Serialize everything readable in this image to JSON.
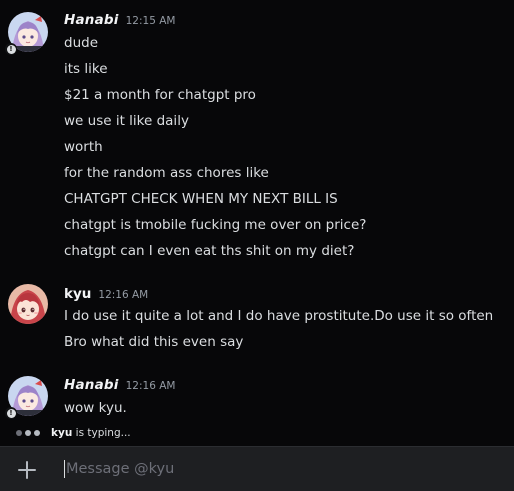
{
  "messages": [
    {
      "author": "Hanabi",
      "time": "12:15 AM",
      "lines": [
        "dude",
        "its like",
        "$21 a month for chatgpt pro",
        "we use it like daily",
        "worth",
        "for the random ass chores like",
        "CHATGPT CHECK WHEN MY NEXT BILL IS",
        "chatgpt is tmobile fucking me over on price?",
        "chatgpt can I even eat ths shit on my diet?"
      ]
    },
    {
      "author": "kyu",
      "time": "12:16 AM",
      "lines": [
        "I do use it quite a lot and I do have prostitute.Do use it so often",
        "Bro what did this even say"
      ]
    },
    {
      "author": "Hanabi",
      "time": "12:16 AM",
      "lines": [
        "wow kyu."
      ]
    }
  ],
  "typing": {
    "user": "kyu",
    "suffix": "is typing..."
  },
  "composer": {
    "placeholder": "Message @kyu",
    "plus_icon": "plus-icon"
  },
  "colors": {
    "background": "#070709",
    "composer_bg": "#1e1f22",
    "text": "#dbdee1",
    "muted": "#949ba4",
    "avatar_hanabi_bg": "#c9d7f0",
    "avatar_kyu_bg": "#e8b9a6"
  }
}
